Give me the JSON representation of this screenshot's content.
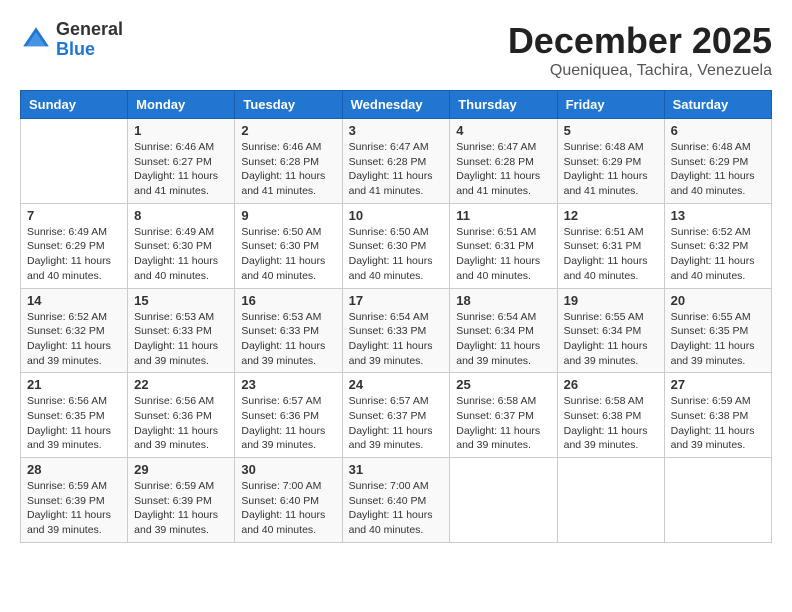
{
  "logo": {
    "general": "General",
    "blue": "Blue"
  },
  "header": {
    "month": "December 2025",
    "location": "Queniquea, Tachira, Venezuela"
  },
  "weekdays": [
    "Sunday",
    "Monday",
    "Tuesday",
    "Wednesday",
    "Thursday",
    "Friday",
    "Saturday"
  ],
  "weeks": [
    [
      {
        "day": "",
        "sunrise": "",
        "sunset": "",
        "daylight": ""
      },
      {
        "day": "1",
        "sunrise": "Sunrise: 6:46 AM",
        "sunset": "Sunset: 6:27 PM",
        "daylight": "Daylight: 11 hours and 41 minutes."
      },
      {
        "day": "2",
        "sunrise": "Sunrise: 6:46 AM",
        "sunset": "Sunset: 6:28 PM",
        "daylight": "Daylight: 11 hours and 41 minutes."
      },
      {
        "day": "3",
        "sunrise": "Sunrise: 6:47 AM",
        "sunset": "Sunset: 6:28 PM",
        "daylight": "Daylight: 11 hours and 41 minutes."
      },
      {
        "day": "4",
        "sunrise": "Sunrise: 6:47 AM",
        "sunset": "Sunset: 6:28 PM",
        "daylight": "Daylight: 11 hours and 41 minutes."
      },
      {
        "day": "5",
        "sunrise": "Sunrise: 6:48 AM",
        "sunset": "Sunset: 6:29 PM",
        "daylight": "Daylight: 11 hours and 41 minutes."
      },
      {
        "day": "6",
        "sunrise": "Sunrise: 6:48 AM",
        "sunset": "Sunset: 6:29 PM",
        "daylight": "Daylight: 11 hours and 40 minutes."
      }
    ],
    [
      {
        "day": "7",
        "sunrise": "Sunrise: 6:49 AM",
        "sunset": "Sunset: 6:29 PM",
        "daylight": "Daylight: 11 hours and 40 minutes."
      },
      {
        "day": "8",
        "sunrise": "Sunrise: 6:49 AM",
        "sunset": "Sunset: 6:30 PM",
        "daylight": "Daylight: 11 hours and 40 minutes."
      },
      {
        "day": "9",
        "sunrise": "Sunrise: 6:50 AM",
        "sunset": "Sunset: 6:30 PM",
        "daylight": "Daylight: 11 hours and 40 minutes."
      },
      {
        "day": "10",
        "sunrise": "Sunrise: 6:50 AM",
        "sunset": "Sunset: 6:30 PM",
        "daylight": "Daylight: 11 hours and 40 minutes."
      },
      {
        "day": "11",
        "sunrise": "Sunrise: 6:51 AM",
        "sunset": "Sunset: 6:31 PM",
        "daylight": "Daylight: 11 hours and 40 minutes."
      },
      {
        "day": "12",
        "sunrise": "Sunrise: 6:51 AM",
        "sunset": "Sunset: 6:31 PM",
        "daylight": "Daylight: 11 hours and 40 minutes."
      },
      {
        "day": "13",
        "sunrise": "Sunrise: 6:52 AM",
        "sunset": "Sunset: 6:32 PM",
        "daylight": "Daylight: 11 hours and 40 minutes."
      }
    ],
    [
      {
        "day": "14",
        "sunrise": "Sunrise: 6:52 AM",
        "sunset": "Sunset: 6:32 PM",
        "daylight": "Daylight: 11 hours and 39 minutes."
      },
      {
        "day": "15",
        "sunrise": "Sunrise: 6:53 AM",
        "sunset": "Sunset: 6:33 PM",
        "daylight": "Daylight: 11 hours and 39 minutes."
      },
      {
        "day": "16",
        "sunrise": "Sunrise: 6:53 AM",
        "sunset": "Sunset: 6:33 PM",
        "daylight": "Daylight: 11 hours and 39 minutes."
      },
      {
        "day": "17",
        "sunrise": "Sunrise: 6:54 AM",
        "sunset": "Sunset: 6:33 PM",
        "daylight": "Daylight: 11 hours and 39 minutes."
      },
      {
        "day": "18",
        "sunrise": "Sunrise: 6:54 AM",
        "sunset": "Sunset: 6:34 PM",
        "daylight": "Daylight: 11 hours and 39 minutes."
      },
      {
        "day": "19",
        "sunrise": "Sunrise: 6:55 AM",
        "sunset": "Sunset: 6:34 PM",
        "daylight": "Daylight: 11 hours and 39 minutes."
      },
      {
        "day": "20",
        "sunrise": "Sunrise: 6:55 AM",
        "sunset": "Sunset: 6:35 PM",
        "daylight": "Daylight: 11 hours and 39 minutes."
      }
    ],
    [
      {
        "day": "21",
        "sunrise": "Sunrise: 6:56 AM",
        "sunset": "Sunset: 6:35 PM",
        "daylight": "Daylight: 11 hours and 39 minutes."
      },
      {
        "day": "22",
        "sunrise": "Sunrise: 6:56 AM",
        "sunset": "Sunset: 6:36 PM",
        "daylight": "Daylight: 11 hours and 39 minutes."
      },
      {
        "day": "23",
        "sunrise": "Sunrise: 6:57 AM",
        "sunset": "Sunset: 6:36 PM",
        "daylight": "Daylight: 11 hours and 39 minutes."
      },
      {
        "day": "24",
        "sunrise": "Sunrise: 6:57 AM",
        "sunset": "Sunset: 6:37 PM",
        "daylight": "Daylight: 11 hours and 39 minutes."
      },
      {
        "day": "25",
        "sunrise": "Sunrise: 6:58 AM",
        "sunset": "Sunset: 6:37 PM",
        "daylight": "Daylight: 11 hours and 39 minutes."
      },
      {
        "day": "26",
        "sunrise": "Sunrise: 6:58 AM",
        "sunset": "Sunset: 6:38 PM",
        "daylight": "Daylight: 11 hours and 39 minutes."
      },
      {
        "day": "27",
        "sunrise": "Sunrise: 6:59 AM",
        "sunset": "Sunset: 6:38 PM",
        "daylight": "Daylight: 11 hours and 39 minutes."
      }
    ],
    [
      {
        "day": "28",
        "sunrise": "Sunrise: 6:59 AM",
        "sunset": "Sunset: 6:39 PM",
        "daylight": "Daylight: 11 hours and 39 minutes."
      },
      {
        "day": "29",
        "sunrise": "Sunrise: 6:59 AM",
        "sunset": "Sunset: 6:39 PM",
        "daylight": "Daylight: 11 hours and 39 minutes."
      },
      {
        "day": "30",
        "sunrise": "Sunrise: 7:00 AM",
        "sunset": "Sunset: 6:40 PM",
        "daylight": "Daylight: 11 hours and 40 minutes."
      },
      {
        "day": "31",
        "sunrise": "Sunrise: 7:00 AM",
        "sunset": "Sunset: 6:40 PM",
        "daylight": "Daylight: 11 hours and 40 minutes."
      },
      {
        "day": "",
        "sunrise": "",
        "sunset": "",
        "daylight": ""
      },
      {
        "day": "",
        "sunrise": "",
        "sunset": "",
        "daylight": ""
      },
      {
        "day": "",
        "sunrise": "",
        "sunset": "",
        "daylight": ""
      }
    ]
  ]
}
